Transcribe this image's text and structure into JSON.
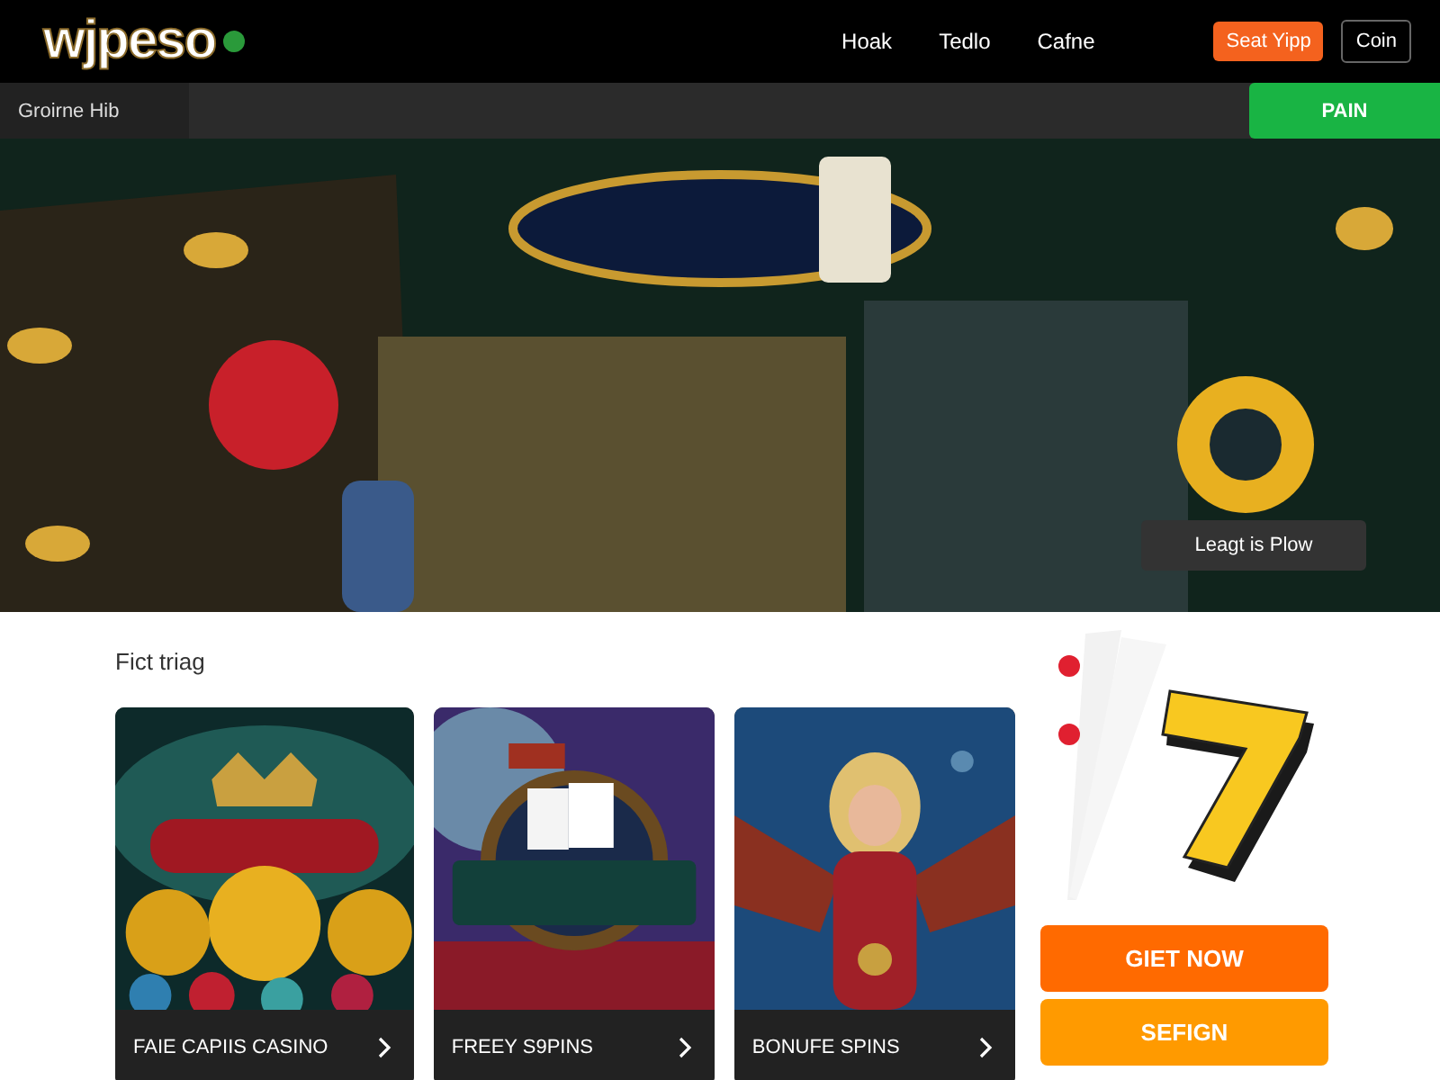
{
  "header": {
    "logo": "wjpeso",
    "nav": [
      "Hoak",
      "Tedlo",
      "Cafne"
    ],
    "buttons": [
      {
        "label": "Seat Yipp",
        "kind": "primary"
      },
      {
        "label": "Coin",
        "kind": "outline"
      }
    ]
  },
  "subbar": {
    "title": "Groirne Hib",
    "button": "PAIN"
  },
  "hero": {
    "kind": "picture",
    "button": "Leagt is Plow"
  },
  "section": {
    "heading": "Fict triag",
    "cards": [
      {
        "title": "FAIE CAPIIS CASINO",
        "kind": "coins"
      },
      {
        "title": "FREEY S9PINS",
        "kind": "ring"
      },
      {
        "title": "BONUFE SPINS",
        "kind": "figure"
      }
    ]
  },
  "side": {
    "kind": "picture",
    "buttons": [
      {
        "label": "GIET NOW",
        "color": "#ff6a00"
      },
      {
        "label": "SEFIGN",
        "color": "#ff9a00"
      }
    ]
  }
}
